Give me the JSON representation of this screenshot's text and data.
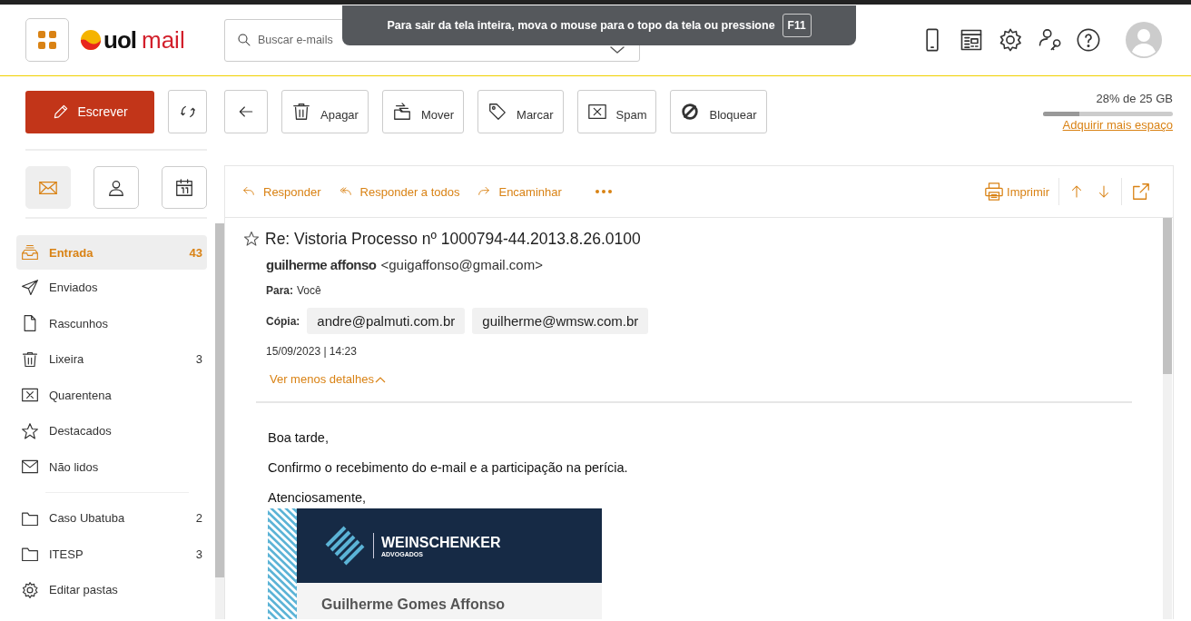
{
  "fullscreen_notice": {
    "text": "Para sair da tela inteira, mova o mouse para o topo da tela ou pressione",
    "key": "F11"
  },
  "header": {
    "logo": {
      "brand": "uol",
      "product": "mail"
    },
    "search": {
      "placeholder": "Buscar e-mails"
    }
  },
  "toolbar": {
    "compose": "Escrever",
    "actions": [
      "Apagar",
      "Mover",
      "Marcar",
      "Spam",
      "Bloquear"
    ]
  },
  "storage": {
    "usage": "28% de 25 GB",
    "level": 0.28,
    "link": "Adquirir mais espaço"
  },
  "sidebar": {
    "tabs": [
      {
        "selected": true
      },
      {
        "selected": false
      },
      {
        "selected": false
      }
    ],
    "folders": [
      {
        "label": "Entrada",
        "count": "43",
        "selected": true
      },
      {
        "label": "Enviados",
        "selected": false
      },
      {
        "label": "Rascunhos",
        "selected": false
      },
      {
        "label": "Lixeira",
        "count": "3",
        "selected": false
      },
      {
        "label": "Quarentena",
        "selected": false
      },
      {
        "label": "Destacados",
        "selected": false
      },
      {
        "label": "Não lidos",
        "selected": false
      }
    ],
    "custom_folders": [
      {
        "label": "Caso Ubatuba",
        "count": "2",
        "selected": false
      },
      {
        "label": "ITESP",
        "count": "3",
        "selected": false
      }
    ],
    "edit_folders": "Editar pastas"
  },
  "message_actions": {
    "reply": [
      "Responder",
      "Responder a todos",
      "Encaminhar"
    ],
    "print": "Imprimir"
  },
  "message": {
    "starred": false,
    "subject": "Re: Vistoria Processo nº 1000794-44.2013.8.26.0100",
    "sender_name": "guilherme affonso",
    "sender_email": "<guigaffonso@gmail.com>",
    "to_label": "Para:",
    "to": "Você",
    "cc_label": "Cópia:",
    "cc": [
      "andre@palmuti.com.br",
      "guilherme@wmsw.com.br"
    ],
    "date": "15/09/2023 | 14:23",
    "details_toggle": "Ver menos detalhes",
    "body": [
      "Boa tarde,",
      "Confirmo o recebimento do e-mail e a participação na perícia.",
      "Atenciosamente,"
    ],
    "signature": {
      "firm": "WEINSCHENKER",
      "firm_subtitle": "ADVOGADOS",
      "name": "Guilherme Gomes Affonso"
    }
  }
}
